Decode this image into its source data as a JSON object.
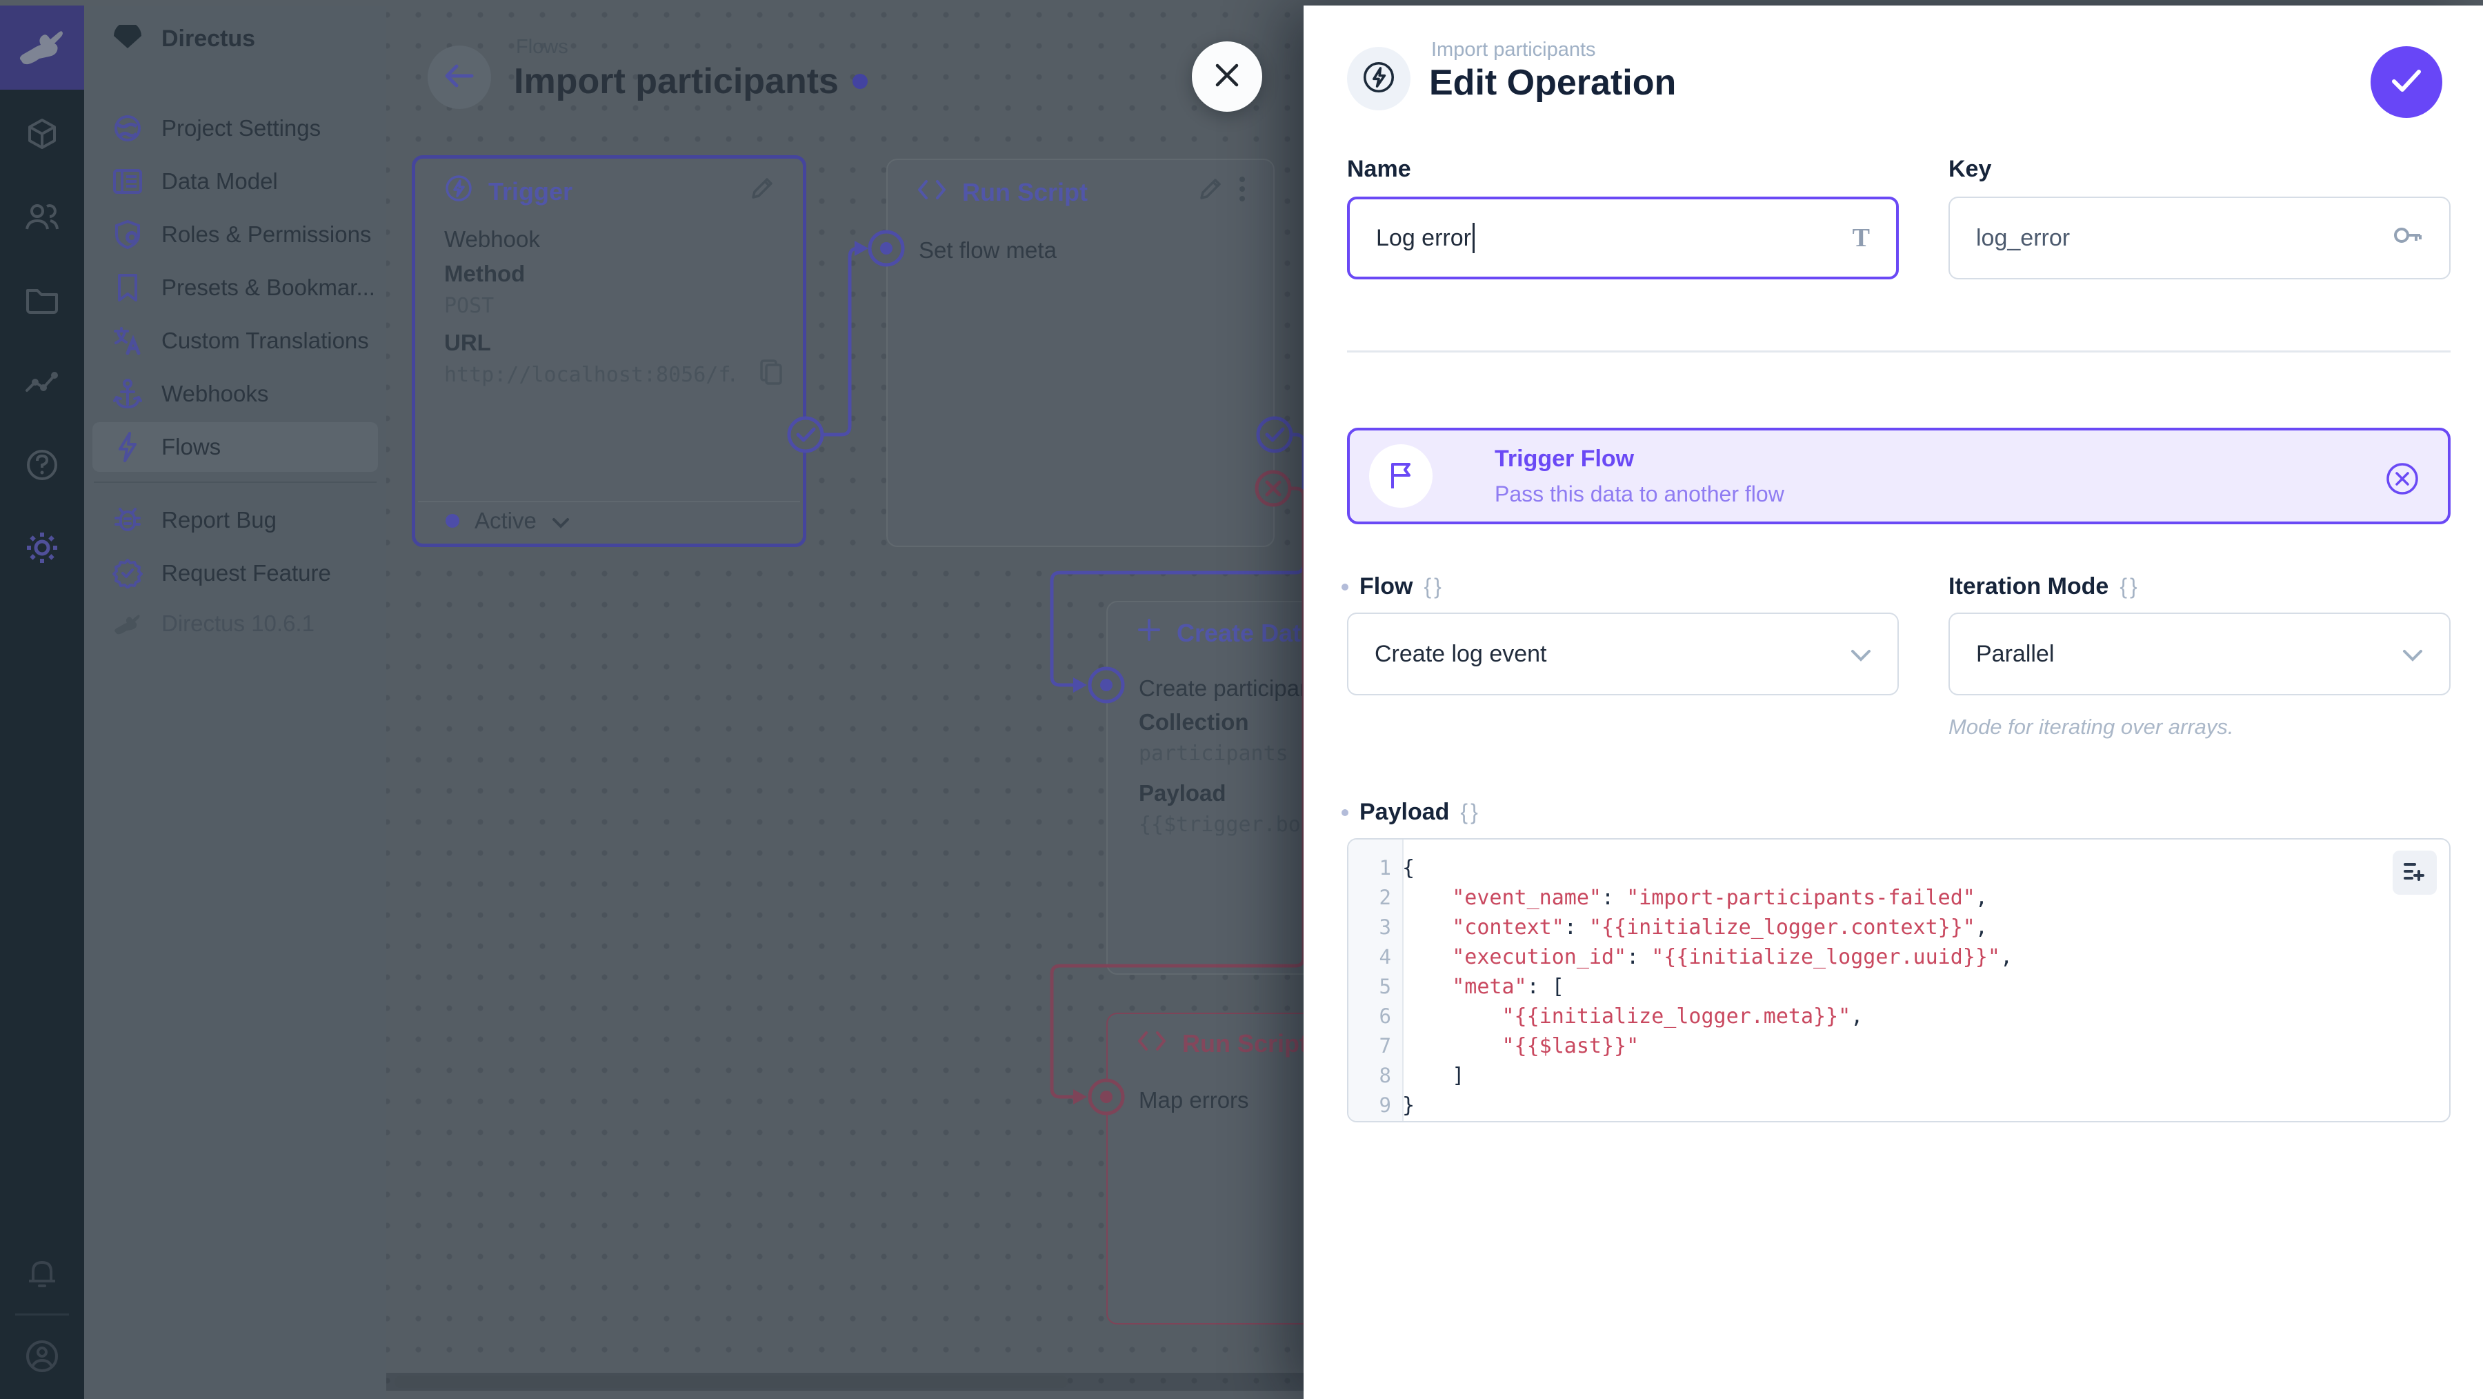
{
  "accent_color": "#6644ff",
  "ui": {
    "braces": "{}"
  },
  "module_bar": {
    "logo_icon": "rabbit-icon",
    "modules": [
      {
        "icon": "cube-icon"
      },
      {
        "icon": "users-icon"
      },
      {
        "icon": "folder-icon"
      },
      {
        "icon": "activity-icon"
      },
      {
        "icon": "help-icon"
      },
      {
        "icon": "gear-icon"
      }
    ],
    "bottom": [
      {
        "icon": "bell-icon"
      },
      {
        "icon": "avatar-icon"
      }
    ]
  },
  "nav": {
    "project_name": "Directus",
    "project_icon": "cloud-icon",
    "items": [
      {
        "label": "Project Settings",
        "icon": "globe-icon"
      },
      {
        "label": "Data Model",
        "icon": "data-model-icon"
      },
      {
        "label": "Roles & Permissions",
        "icon": "shield-icon"
      },
      {
        "label": "Presets & Bookmar...",
        "icon": "bookmark-icon"
      },
      {
        "label": "Custom Translations",
        "icon": "translate-icon"
      },
      {
        "label": "Webhooks",
        "icon": "anchor-icon"
      },
      {
        "label": "Flows",
        "icon": "bolt-icon"
      }
    ],
    "footer_items": [
      {
        "label": "Report Bug",
        "icon": "bug-icon"
      },
      {
        "label": "Request Feature",
        "icon": "badge-check-icon"
      }
    ],
    "version": "Directus 10.6.1"
  },
  "canvas": {
    "breadcrumb": "Flows",
    "title": "Import participants",
    "trigger_panel": {
      "title": "Trigger",
      "type": "Webhook",
      "method_label": "Method",
      "method": "POST",
      "url_label": "URL",
      "url": "http://localhost:8056/f…",
      "status": "Active"
    },
    "run_script_panel": {
      "title": "Run Script",
      "name": "Set flow meta"
    },
    "create_data_panel": {
      "title": "Create Data",
      "name": "Create participant",
      "collection_label": "Collection",
      "collection": "participants",
      "payload_label": "Payload",
      "payload": "{{$trigger.bod"
    },
    "map_errors_panel": {
      "title": "Run Script",
      "name": "Map errors"
    }
  },
  "drawer": {
    "breadcrumb": "Import participants",
    "title": "Edit Operation",
    "name_field": {
      "label": "Name",
      "value": "Log error"
    },
    "key_field": {
      "label": "Key",
      "value": "log_error"
    },
    "banner": {
      "title": "Trigger Flow",
      "subtitle": "Pass this data to another flow"
    },
    "flow_field": {
      "label": "Flow",
      "value": "Create log event"
    },
    "iteration_field": {
      "label": "Iteration Mode",
      "value": "Parallel",
      "note": "Mode for iterating over arrays."
    },
    "payload_field": {
      "label": "Payload",
      "lines": [
        [
          {
            "t": "{",
            "c": "p"
          }
        ],
        [
          {
            "t": "    ",
            "c": "p"
          },
          {
            "t": "\"event_name\"",
            "c": "s"
          },
          {
            "t": ": ",
            "c": "p"
          },
          {
            "t": "\"import-participants-failed\"",
            "c": "s"
          },
          {
            "t": ",",
            "c": "p"
          }
        ],
        [
          {
            "t": "    ",
            "c": "p"
          },
          {
            "t": "\"context\"",
            "c": "s"
          },
          {
            "t": ": ",
            "c": "p"
          },
          {
            "t": "\"{{initialize_logger.context}}\"",
            "c": "s"
          },
          {
            "t": ",",
            "c": "p"
          }
        ],
        [
          {
            "t": "    ",
            "c": "p"
          },
          {
            "t": "\"execution_id\"",
            "c": "s"
          },
          {
            "t": ": ",
            "c": "p"
          },
          {
            "t": "\"{{initialize_logger.uuid}}\"",
            "c": "s"
          },
          {
            "t": ",",
            "c": "p"
          }
        ],
        [
          {
            "t": "    ",
            "c": "p"
          },
          {
            "t": "\"meta\"",
            "c": "s"
          },
          {
            "t": ": [",
            "c": "p"
          }
        ],
        [
          {
            "t": "        ",
            "c": "p"
          },
          {
            "t": "\"{{initialize_logger.meta}}\"",
            "c": "s"
          },
          {
            "t": ",",
            "c": "p"
          }
        ],
        [
          {
            "t": "        ",
            "c": "p"
          },
          {
            "t": "\"{{$last}}\"",
            "c": "s"
          }
        ],
        [
          {
            "t": "    ]",
            "c": "p"
          }
        ],
        [
          {
            "t": "}",
            "c": "p"
          }
        ]
      ]
    }
  }
}
